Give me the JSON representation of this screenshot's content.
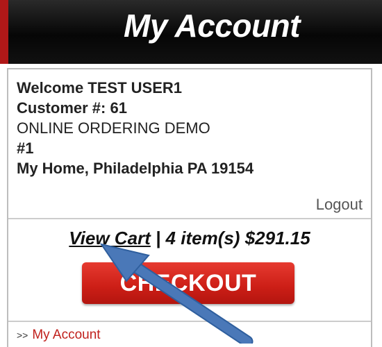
{
  "header": {
    "title": "My Account"
  },
  "account": {
    "welcome": "Welcome TEST USER1",
    "customer_number": "Customer #: 61",
    "company": "ONLINE ORDERING DEMO",
    "location_number": "#1",
    "address": "My Home, Philadelphia PA 19154",
    "logout_label": "Logout"
  },
  "cart": {
    "view_cart_label": "View Cart",
    "summary": " | 4 item(s) $291.15",
    "checkout_label": "CHECKOUT"
  },
  "nav": {
    "chevron": ">>",
    "my_account_label": "My Account"
  },
  "colors": {
    "header_bg": "#0a0a0a",
    "checkout_red": "#d2241b",
    "link_red": "#c0201c",
    "arrow_blue": "#4a78b8"
  },
  "annotation": {
    "arrow_icon": "pointer-arrow-icon"
  }
}
